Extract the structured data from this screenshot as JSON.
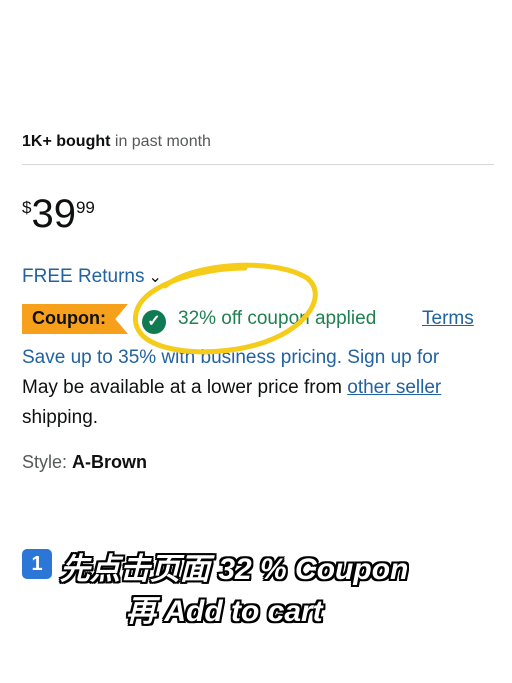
{
  "product": {
    "bought_bold": "1K+ bought",
    "bought_rest": " in past month",
    "price": {
      "symbol": "$",
      "whole": "39",
      "fraction": "99"
    },
    "free_returns": "FREE Returns",
    "coupon_badge": "Coupon:",
    "coupon_applied": "32% off coupon applied",
    "terms_link": "Terms",
    "business_text": "Save up to 35% with business pricing. Sign up for",
    "lower_price_text": "May be available at a lower price from ",
    "other_sellers_link": "other seller",
    "shipping_text": "shipping.",
    "style_label": "Style: ",
    "style_value": "A-Brown"
  },
  "annotation": {
    "step_number": "1",
    "caption_line1": "先点击页面 32 % Coupon",
    "caption_line2": "再 Add to cart",
    "highlight_color": "#f5cc1a"
  },
  "colors": {
    "link": "#2162a1",
    "coupon_badge": "#f7a01b",
    "applied_green": "#1f8051"
  }
}
